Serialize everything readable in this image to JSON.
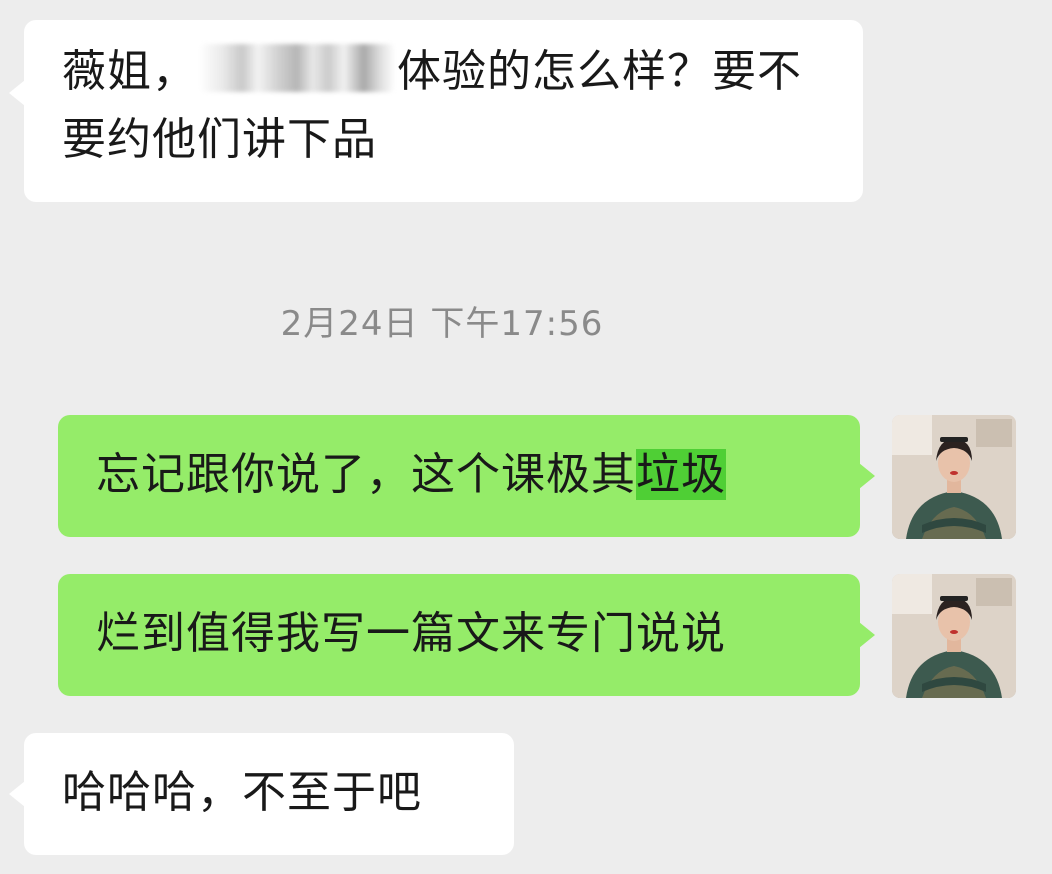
{
  "chat": {
    "messages": [
      {
        "sender": "other",
        "text_before": "薇姐，",
        "text_after": "体验的怎么样？要不要约他们讲下品"
      },
      {
        "sender": "self",
        "text": "忘记跟你说了，这个课极其",
        "highlighted_text": "垃圾"
      },
      {
        "sender": "self",
        "text": "烂到值得我写一篇文来专门说说"
      },
      {
        "sender": "other",
        "text": "哈哈哈，不至于吧"
      }
    ],
    "timestamp": "2月24日 下午17:56"
  },
  "colors": {
    "background": "#ededed",
    "incoming_bubble": "#ffffff",
    "outgoing_bubble": "#95ec69",
    "selection_highlight": "#4fcf35",
    "timestamp_text": "#8a8a8a"
  },
  "icons": {
    "avatar": "user-avatar-photo"
  }
}
